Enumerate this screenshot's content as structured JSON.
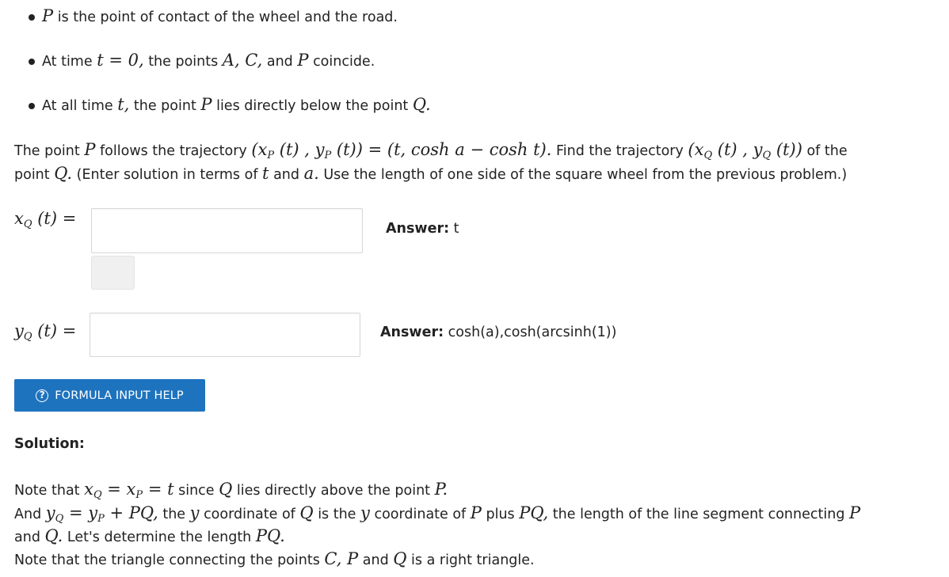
{
  "bullets": [
    {
      "v": "P",
      "text": " is the point of contact of the wheel and the road."
    },
    {
      "a": "At time ",
      "m1": "t = 0,",
      "b": " the points ",
      "m2": "A, C,",
      "c": " and ",
      "m3": "P",
      "d": " coincide."
    },
    {
      "a": "At all time ",
      "m1": "t,",
      "b": " the point ",
      "m2": "P",
      "c": " lies directly below the point ",
      "m3": "Q."
    }
  ],
  "problem": {
    "line1_a": "The point ",
    "line1_P": "P",
    "line1_b": " follows the trajectory ",
    "traj_P": "(x",
    "traj_P_sub": "P",
    "traj_P_mid": " (t) , y",
    "traj_P_sub2": "P",
    "traj_P_end": " (t)) = (t, cosh a − cosh t).",
    "line1_c": " Find the trajectory ",
    "traj_Q": "(x",
    "traj_Q_sub": "Q",
    "traj_Q_mid": " (t) , y",
    "traj_Q_sub2": "Q",
    "traj_Q_end": " (t))",
    "line1_d": " of the",
    "line2_a": "point ",
    "line2_Q": "Q.",
    "line2_b": " (Enter solution in terms of ",
    "line2_t": "t",
    "line2_c": " and ",
    "line2_a2": "a.",
    "line2_d": " Use the length of one side of the square wheel from the previous problem.)"
  },
  "fields": {
    "xq_label": "x",
    "xq_sub": "Q",
    "xq_rest": " (t) =",
    "xq_value": "",
    "xq_answer_label": "Answer:",
    "xq_answer": " t",
    "yq_label": "y",
    "yq_sub": "Q",
    "yq_rest": " (t) =",
    "yq_value": "",
    "yq_answer_label": "Answer:",
    "yq_answer": " cosh(a),cosh(arcsinh(1))"
  },
  "help_button": {
    "icon": "?",
    "label": "FORMULA INPUT HELP"
  },
  "solution": {
    "heading": "Solution:",
    "s1_a": "Note that ",
    "s1_m": "x",
    "s1_sub": "Q",
    "s1_m2": " = x",
    "s1_sub2": "P",
    "s1_m3": " = t",
    "s1_b": " since ",
    "s1_Q": "Q",
    "s1_c": " lies directly above the point ",
    "s1_P": "P.",
    "s2_a": "And ",
    "s2_m": "y",
    "s2_sub": "Q",
    "s2_m2": " = y",
    "s2_sub2": "P",
    "s2_m3": " + PQ,",
    "s2_b": " the ",
    "s2_y": "y",
    "s2_c": " coordinate of ",
    "s2_Q": "Q",
    "s2_d": " is the ",
    "s2_y2": "y",
    "s2_e": " coordinate of ",
    "s2_P": "P",
    "s2_f": " plus ",
    "s2_PQ": "PQ,",
    "s2_g": " the length of the line segment connecting ",
    "s2_P2": "P",
    "s3_a": "and ",
    "s3_Q": "Q.",
    "s3_b": " Let's determine the length ",
    "s3_PQ": "PQ.",
    "s4_a": "Note that the triangle connecting the points ",
    "s4_m": "C, P",
    "s4_b": " and ",
    "s4_Q": "Q",
    "s4_c": " is a right triangle."
  }
}
